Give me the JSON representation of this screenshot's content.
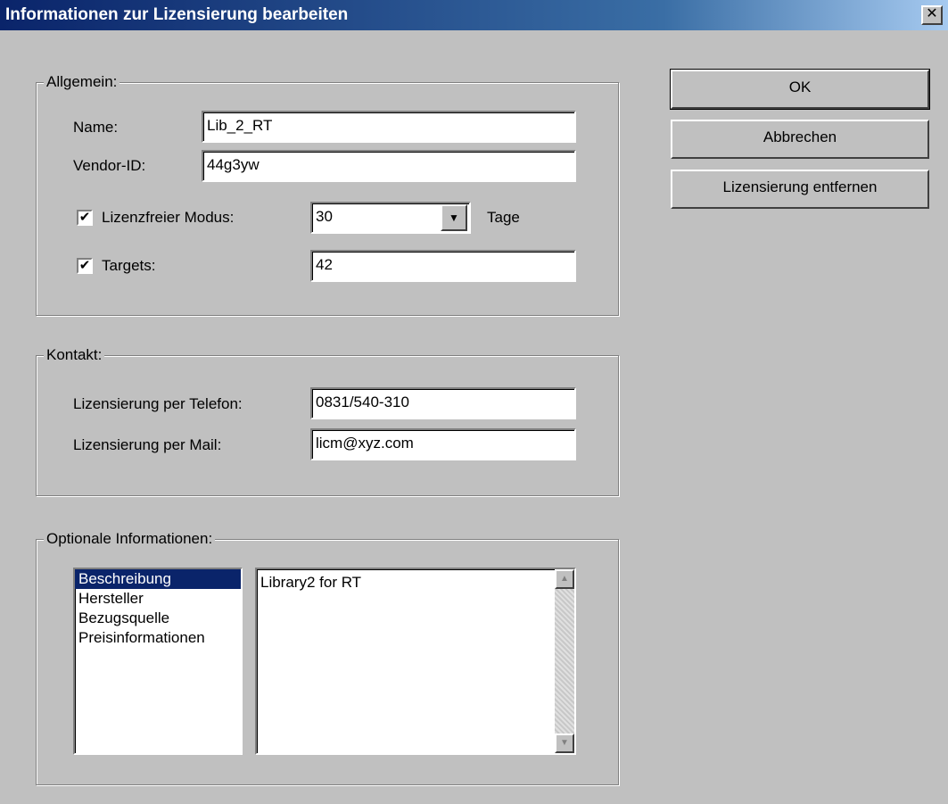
{
  "window": {
    "title": "Informationen zur Lizensierung bearbeiten",
    "close_glyph": "✕"
  },
  "buttons": {
    "ok": "OK",
    "cancel": "Abbrechen",
    "remove": "Lizensierung entfernen"
  },
  "general": {
    "legend": "Allgemein:",
    "name_label": "Name:",
    "name_value": "Lib_2_RT",
    "vendor_label": "Vendor-ID:",
    "vendor_value": "44g3yw",
    "licfree_label": "Lizenzfreier Modus:",
    "licfree_checked": true,
    "licfree_value": "30",
    "licfree_unit": "Tage",
    "targets_label": "Targets:",
    "targets_checked": true,
    "targets_value": "42"
  },
  "contact": {
    "legend": "Kontakt:",
    "phone_label": "Lizensierung per Telefon:",
    "phone_value": "0831/540-310",
    "mail_label": "Lizensierung per Mail:",
    "mail_value": "licm@xyz.com"
  },
  "optional": {
    "legend": "Optionale Informationen:",
    "items": [
      "Beschreibung",
      "Hersteller",
      "Bezugsquelle",
      "Preisinformationen"
    ],
    "selected_index": 0,
    "text": "Library2 for RT"
  },
  "icons": {
    "check": "✔",
    "dropdown": "▼",
    "scroll_up": "▲",
    "scroll_down": "▼"
  },
  "colors": {
    "title_start": "#0a246a",
    "selection": "#0a246a",
    "face": "#c0c0c0"
  }
}
